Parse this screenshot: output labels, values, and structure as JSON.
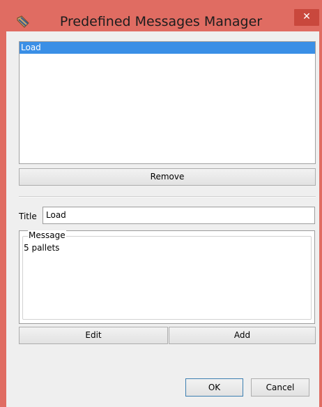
{
  "window": {
    "title": "Predefined Messages Manager",
    "close_label": "✕",
    "accent_color": "#e06c62"
  },
  "messages_list": {
    "items": [
      "Load"
    ],
    "selected_index": 0
  },
  "buttons": {
    "remove": "Remove",
    "edit": "Edit",
    "add": "Add",
    "ok": "OK",
    "cancel": "Cancel"
  },
  "title_field": {
    "label": "Title",
    "value": "Load"
  },
  "message_field": {
    "legend": "Message",
    "value": "5 pallets"
  }
}
